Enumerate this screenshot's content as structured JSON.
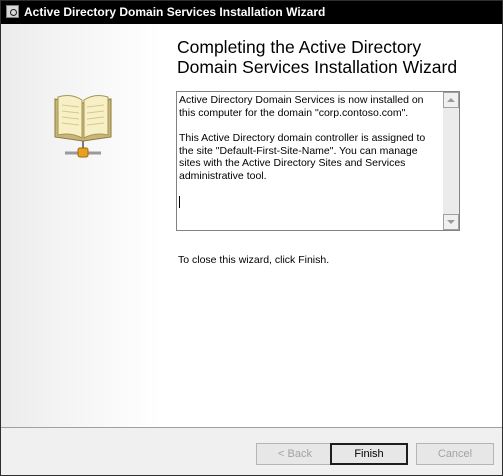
{
  "window": {
    "title": "Active Directory Domain Services Installation Wizard"
  },
  "side_panel": {
    "icon": "open-book-network-icon"
  },
  "content": {
    "heading": "Completing the Active Directory Domain Services Installation Wizard",
    "summary": {
      "paragraph1": "Active Directory Domain Services is now installed on this computer for the domain \"corp.contoso.com\".",
      "paragraph2": "This Active Directory domain controller is assigned to the site \"Default-First-Site-Name\". You can manage sites with the Active Directory Sites and Services administrative tool."
    },
    "close_instruction": "To close this wizard, click Finish."
  },
  "buttons": {
    "back": "< Back",
    "finish": "Finish",
    "cancel": "Cancel"
  },
  "colors": {
    "titlebar": "#000000",
    "book_pages": "#f5ecbf",
    "network_node": "#e8a020"
  }
}
